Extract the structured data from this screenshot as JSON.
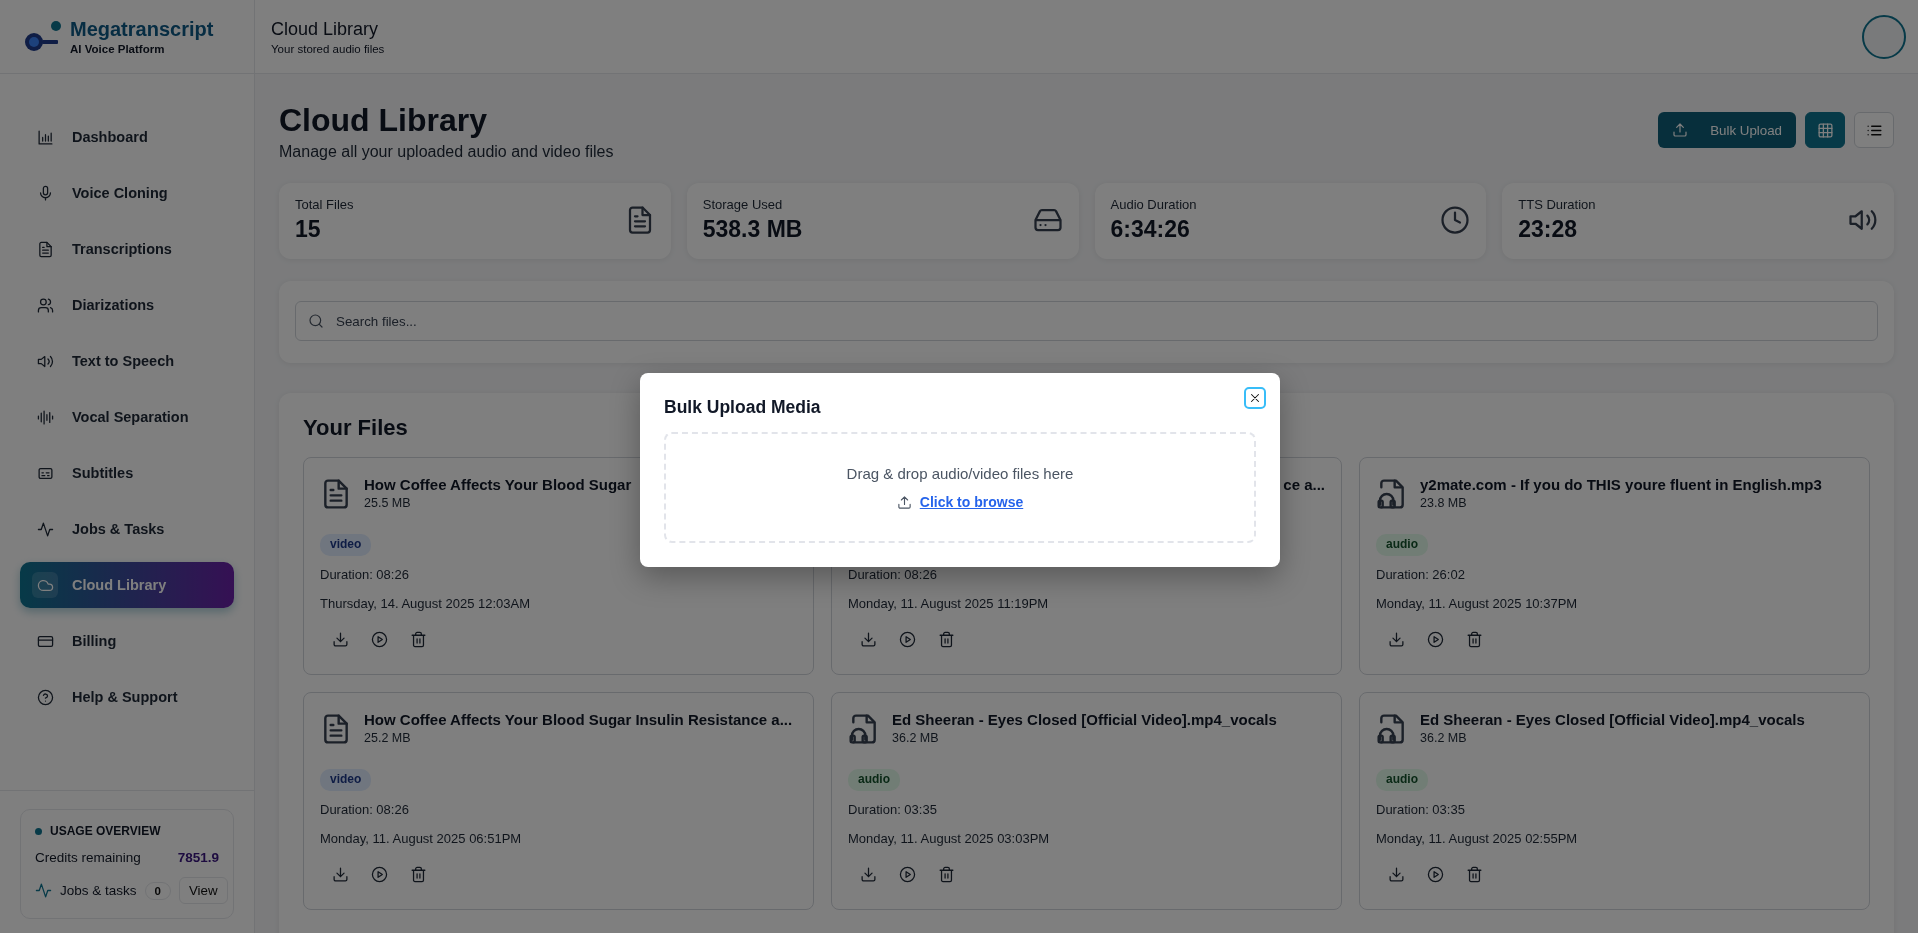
{
  "brand": {
    "name": "Megatranscript",
    "tagline": "AI Voice Platform"
  },
  "sidebar": {
    "items": [
      {
        "label": "Dashboard",
        "selected": false
      },
      {
        "label": "Voice Cloning",
        "selected": false
      },
      {
        "label": "Transcriptions",
        "selected": false
      },
      {
        "label": "Diarizations",
        "selected": false
      },
      {
        "label": "Text to Speech",
        "selected": false
      },
      {
        "label": "Vocal Separation",
        "selected": false
      },
      {
        "label": "Subtitles",
        "selected": false
      },
      {
        "label": "Jobs & Tasks",
        "selected": false
      },
      {
        "label": "Cloud Library",
        "selected": true
      },
      {
        "label": "Billing",
        "selected": false
      },
      {
        "label": "Help & Support",
        "selected": false
      }
    ]
  },
  "usage": {
    "title": "USAGE OVERVIEW",
    "credits_label": "Credits remaining",
    "credits": "7851.9",
    "jobs_label": "Jobs & tasks",
    "jobs_count": "0",
    "view_button": "View"
  },
  "header": {
    "title": "Cloud Library",
    "subtitle": "Your stored audio files"
  },
  "page": {
    "title": "Cloud Library",
    "subtitle": "Manage all your uploaded audio and video files",
    "upload_button": "Bulk Upload",
    "view_modes": [
      {
        "kind": "grid",
        "selected": true
      },
      {
        "kind": "list",
        "selected": false
      }
    ]
  },
  "stats": [
    {
      "label": "Total Files",
      "value": "15"
    },
    {
      "label": "Storage Used",
      "value": "538.3 MB"
    },
    {
      "label": "Audio Duration",
      "value": "6:34:26"
    },
    {
      "label": "TTS Duration",
      "value": "23:28"
    }
  ],
  "search": {
    "placeholder": "Search files..."
  },
  "files_title": "Your Files",
  "files": [
    {
      "kind": "video",
      "title": "How Coffee Affects Your Blood Sugar",
      "size": "25.5 MB",
      "tag": "video",
      "duration": "Duration: 08:26",
      "date": "Thursday, 14. August 2025 12:03AM"
    },
    {
      "kind": "covered",
      "title": "ce a...",
      "duration": "Duration: 08:26",
      "date": "Monday, 11. August 2025 11:19PM"
    },
    {
      "kind": "audio",
      "title": "y2mate.com - If you do THIS youre fluent in English.mp3",
      "size": "23.8 MB",
      "tag": "audio",
      "duration": "Duration: 26:02",
      "date": "Monday, 11. August 2025 10:37PM"
    },
    {
      "kind": "video",
      "title": "How Coffee Affects Your Blood Sugar Insulin Resistance a...",
      "size": "25.2 MB",
      "tag": "video",
      "duration": "Duration: 08:26",
      "date": "Monday, 11. August 2025 06:51PM"
    },
    {
      "kind": "audio",
      "title": "Ed Sheeran - Eyes Closed [Official Video].mp4_vocals",
      "size": "36.2 MB",
      "tag": "audio",
      "duration": "Duration: 03:35",
      "date": "Monday, 11. August 2025 03:03PM"
    },
    {
      "kind": "audio",
      "title": "Ed Sheeran - Eyes Closed [Official Video].mp4_vocals",
      "size": "36.2 MB",
      "tag": "audio",
      "duration": "Duration: 03:35",
      "date": "Monday, 11. August 2025 02:55PM"
    }
  ],
  "modal": {
    "title": "Bulk Upload Media",
    "drop_text": "Drag & drop audio/video files here",
    "browse_link": "Click to browse"
  }
}
